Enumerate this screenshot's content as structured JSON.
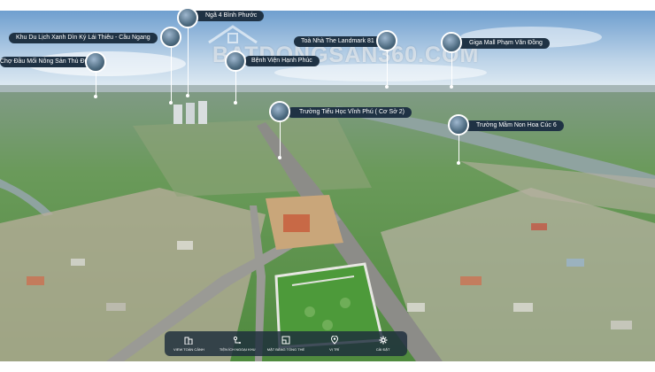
{
  "watermark": {
    "text": "BATDONGSAN360.COM"
  },
  "poi": {
    "nga4": "Ngã 4 Bình Phước",
    "khudulich": "Khu Du Lịch Xanh Dìn Ký Lái Thiêu - Cầu Ngang",
    "chodau": "Chợ Đầu Mối Nông Sản Thủ Đức",
    "landmark": "Toà Nhà The Landmark 81",
    "gigamall": "Giga Mall Phạm Văn Đồng",
    "benhvien": "Bệnh Viện Hạnh Phúc",
    "truongth": "Trường Tiểu Học Vĩnh Phú ( Cơ Sở 2)",
    "truongmn": "Trường Mầm Non Hoa Cúc 6"
  },
  "toolbar": {
    "items": [
      {
        "label": "VIEW TOÀN CẢNH",
        "icon": "building-icon"
      },
      {
        "label": "TIỆN ÍCH NGOẠI KHU",
        "icon": "map-route-icon"
      },
      {
        "label": "MẶT BẰNG TỔNG THỂ",
        "icon": "floorplan-icon"
      },
      {
        "label": "VỊ TRÍ",
        "icon": "location-icon"
      },
      {
        "label": "CÀI ĐẶT",
        "icon": "gear-icon"
      }
    ]
  },
  "colors": {
    "label_bg": "#1f3244",
    "toolbar_bg": "#1c2c3c",
    "river": "#8fa3a0",
    "sky": "#c9ddf0"
  }
}
